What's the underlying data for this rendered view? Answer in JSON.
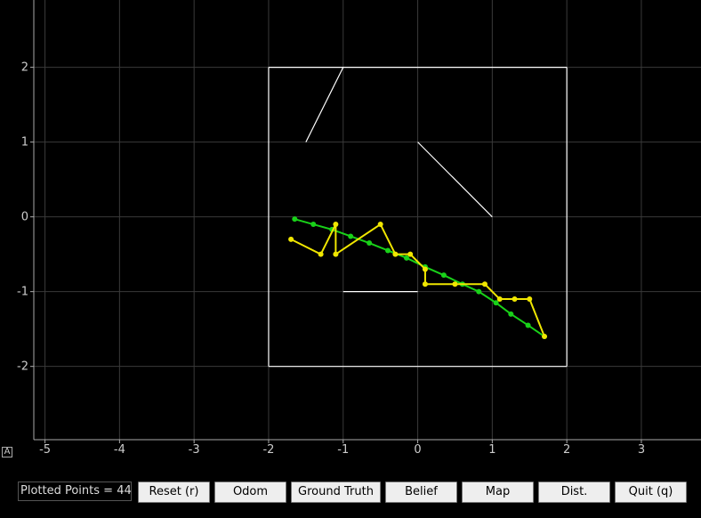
{
  "chart_data": {
    "type": "scatter",
    "xlim": [
      -5.15,
      3.8
    ],
    "ylim": [
      -2.98,
      2.9
    ],
    "xticks": [
      -5,
      -4,
      -3,
      -2,
      -1,
      0,
      1,
      2,
      3
    ],
    "yticks": [
      -2,
      -1,
      0,
      1,
      2
    ],
    "xtick_labels": [
      "-5",
      "-4",
      "-3",
      "-2",
      "-1",
      "0",
      "1",
      "2",
      "3"
    ],
    "ytick_labels": [
      "-2",
      "-1",
      "0",
      "1",
      "2"
    ],
    "grid": true,
    "map_segments": [
      [
        [
          -2,
          -2
        ],
        [
          2,
          -2
        ]
      ],
      [
        [
          2,
          -2
        ],
        [
          2,
          2
        ]
      ],
      [
        [
          2,
          2
        ],
        [
          -2,
          2
        ]
      ],
      [
        [
          -2,
          2
        ],
        [
          -2,
          -2
        ]
      ],
      [
        [
          -1.5,
          1.0
        ],
        [
          -1.0,
          2.0
        ]
      ],
      [
        [
          0,
          1.0
        ],
        [
          1.0,
          0
        ]
      ],
      [
        [
          -1.0,
          -1.0
        ],
        [
          0,
          -1.0
        ]
      ]
    ],
    "series": [
      {
        "color": "#19d119",
        "values": [
          [
            -1.65,
            -0.03
          ],
          [
            -1.4,
            -0.1
          ],
          [
            -1.15,
            -0.17
          ],
          [
            -0.9,
            -0.26
          ],
          [
            -0.65,
            -0.35
          ],
          [
            -0.4,
            -0.45
          ],
          [
            -0.15,
            -0.55
          ],
          [
            0.1,
            -0.67
          ],
          [
            0.35,
            -0.78
          ],
          [
            0.6,
            -0.9
          ],
          [
            0.82,
            -1.0
          ],
          [
            1.05,
            -1.15
          ],
          [
            1.25,
            -1.3
          ],
          [
            1.48,
            -1.45
          ],
          [
            1.7,
            -1.6
          ]
        ]
      },
      {
        "color": "#f0e600",
        "values": [
          [
            -1.7,
            -0.3
          ],
          [
            -1.3,
            -0.5
          ],
          [
            -1.1,
            -0.1
          ],
          [
            -1.1,
            -0.5
          ],
          [
            -0.5,
            -0.1
          ],
          [
            -0.3,
            -0.5
          ],
          [
            -0.1,
            -0.5
          ],
          [
            0.1,
            -0.7
          ],
          [
            0.1,
            -0.9
          ],
          [
            0.5,
            -0.9
          ],
          [
            0.9,
            -0.9
          ],
          [
            1.1,
            -1.1
          ],
          [
            1.3,
            -1.1
          ],
          [
            1.5,
            -1.1
          ],
          [
            1.7,
            -1.6
          ]
        ]
      }
    ],
    "distance_segment": [
      [
        1.5,
        -1.1
      ],
      [
        1.7,
        -1.6
      ]
    ],
    "distance_color": "#5f86c9"
  },
  "status": {
    "text": "Plotted Points = 44"
  },
  "buttons": {
    "reset": "Reset (r)",
    "odom": "Odom",
    "ground_truth": "Ground Truth",
    "belief": "Belief",
    "map": "Map",
    "dist": "Dist.",
    "quit": "Quit (q)"
  },
  "corner_icon": "A"
}
